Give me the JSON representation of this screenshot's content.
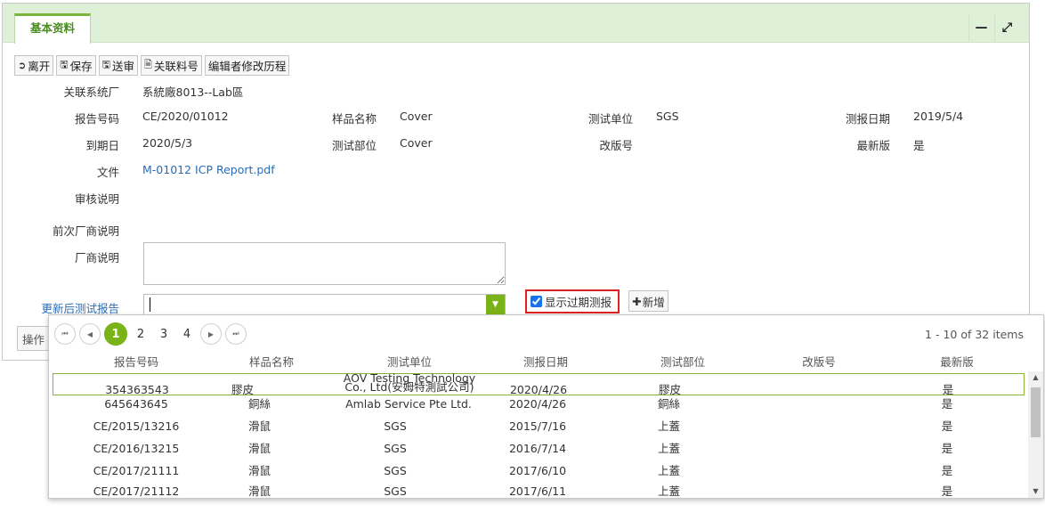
{
  "tab": {
    "label": "基本资料"
  },
  "toolbar": {
    "leave": "离开",
    "save": "保存",
    "submit": "送审",
    "related": "关联料号",
    "history": "编辑者修改历程"
  },
  "form": {
    "system_label": "关联系统厂",
    "system_value": "系統廠8013--Lab區",
    "report_no_label": "报告号码",
    "report_no_value": "CE/2020/01012",
    "sample_label": "样品名称",
    "sample_value": "Cover",
    "unit_label": "测试单位",
    "unit_value": "SGS",
    "date_label": "测报日期",
    "date_value": "2019/5/4",
    "expire_label": "到期日",
    "expire_value": "2020/5/3",
    "part_label": "测试部位",
    "part_value": "Cover",
    "revision_label": "改版号",
    "revision_value": "",
    "latest_label": "最新版",
    "latest_value": "是",
    "file_label": "文件",
    "file_value": "M-01012 ICP Report.pdf",
    "review_label": "审核说明",
    "prev_vendor_label": "前次厂商说明",
    "vendor_label": "厂商说明",
    "updated_report_label": "更新后测试报告",
    "show_expired_label": "显示过期测报",
    "add_label": "新增",
    "op_label": "操作"
  },
  "popup": {
    "pages": [
      "1",
      "2",
      "3",
      "4"
    ],
    "items_text": "1 - 10 of 32 items",
    "columns": [
      "报告号码",
      "样品名称",
      "测试单位",
      "测报日期",
      "测试部位",
      "改版号",
      "最新版"
    ],
    "rows": [
      {
        "no": "354363543",
        "sample": "膠皮",
        "unit1": "AOV Testing Technology",
        "unit2": "Co., Ltd(安姆特測試公司)",
        "date": "2020/4/26",
        "part": "膠皮",
        "rev": "",
        "latest": "是"
      },
      {
        "no": "645643645",
        "sample": "銅絲",
        "unit1": "Amlab Service Pte Ltd.",
        "unit2": "",
        "date": "2020/4/26",
        "part": "銅絲",
        "rev": "",
        "latest": "是"
      },
      {
        "no": "CE/2015/13216",
        "sample": "滑鼠",
        "unit1": "SGS",
        "unit2": "",
        "date": "2015/7/16",
        "part": "上蓋",
        "rev": "",
        "latest": "是"
      },
      {
        "no": "CE/2016/13215",
        "sample": "滑鼠",
        "unit1": "SGS",
        "unit2": "",
        "date": "2016/7/14",
        "part": "上蓋",
        "rev": "",
        "latest": "是"
      },
      {
        "no": "CE/2017/21111",
        "sample": "滑鼠",
        "unit1": "SGS",
        "unit2": "",
        "date": "2017/6/10",
        "part": "上蓋",
        "rev": "",
        "latest": "是"
      },
      {
        "no": "CE/2017/21112",
        "sample": "滑鼠",
        "unit1": "SGS",
        "unit2": "",
        "date": "2017/6/11",
        "part": "上蓋",
        "rev": "",
        "latest": "是"
      }
    ]
  },
  "colors": {
    "accent": "#7ab317",
    "header_bg": "#dff0d8",
    "link": "#2a6db5",
    "highlight": "#e02020"
  }
}
